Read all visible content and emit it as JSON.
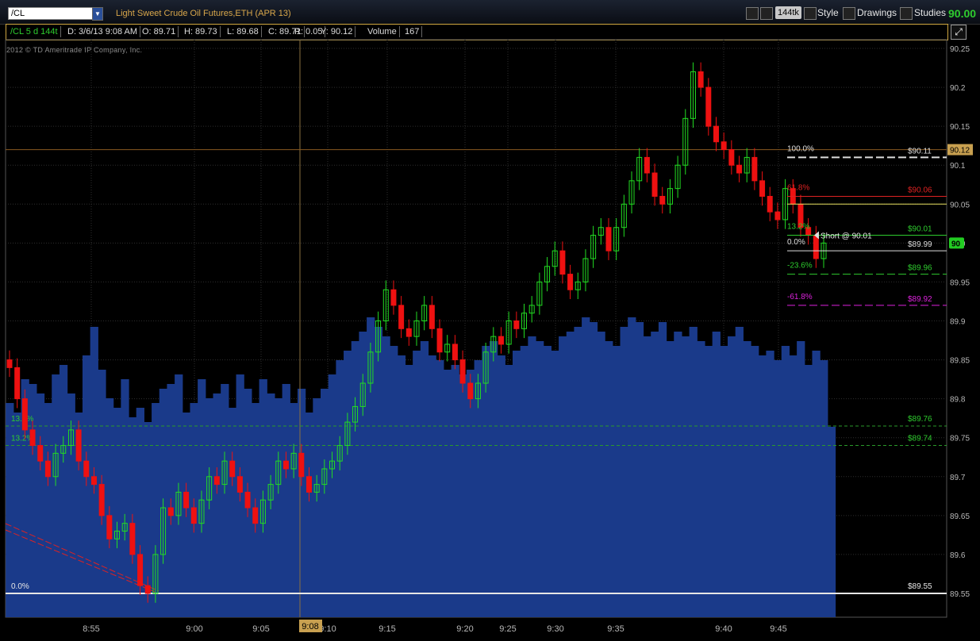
{
  "toolbar": {
    "symbol": "/CL",
    "symbol_arrow": "▼",
    "description": "Light Sweet Crude Oil Futures,ETH (APR 13)",
    "tick_badge": "144tk",
    "style_label": "Style",
    "drawings_label": "Drawings",
    "studies_label": "Studies",
    "last_price": "90.00"
  },
  "info_bar": {
    "chart_label": "/CL 5 d 144t",
    "date": "D: 3/6/13 9:08 AM",
    "open": "O: 89.71",
    "high": "H: 89.73",
    "low": "L: 89.68",
    "close": "C: 89.71",
    "range": "R: 0.05",
    "y": "Y: 90.12",
    "volume_label": "Volume",
    "volume_value": "167"
  },
  "copyright": "2012 © TD Ameritrade IP Company, Inc.",
  "colors": {
    "up": "#22dd22",
    "down": "#ee1111",
    "volume": "#1a3a8a",
    "grid": "#3a3a3a"
  },
  "chart_data": {
    "type": "candlestick",
    "ylim": [
      89.55,
      90.25
    ],
    "y_ticks": [
      "90.25",
      "90.2",
      "90.15",
      "90.1",
      "90.05",
      "90.0",
      "89.95",
      "89.9",
      "89.85",
      "89.8",
      "89.75",
      "89.7",
      "89.65",
      "89.6",
      "89.55"
    ],
    "x_ticks": [
      "8:55",
      "9:00",
      "9:05",
      "9:10",
      "9:15",
      "9:20",
      "9:25",
      "9:30",
      "9:35",
      "9:40",
      "9:45"
    ],
    "cursor_time": "9:08",
    "crosshair_price": "90.12",
    "current_price_tag": "90",
    "price_series": [
      89.84,
      89.8,
      89.76,
      89.74,
      89.72,
      89.7,
      89.73,
      89.74,
      89.76,
      89.72,
      89.7,
      89.69,
      89.65,
      89.62,
      89.63,
      89.64,
      89.6,
      89.56,
      89.55,
      89.6,
      89.66,
      89.65,
      89.68,
      89.66,
      89.64,
      89.67,
      89.7,
      89.69,
      89.72,
      89.7,
      89.68,
      89.66,
      89.64,
      89.67,
      89.69,
      89.72,
      89.71,
      89.73,
      89.7,
      89.68,
      89.69,
      89.71,
      89.72,
      89.74,
      89.77,
      89.79,
      89.82,
      89.86,
      89.9,
      89.94,
      89.92,
      89.89,
      89.88,
      89.9,
      89.92,
      89.89,
      89.86,
      89.87,
      89.85,
      89.82,
      89.8,
      89.82,
      89.86,
      89.88,
      89.87,
      89.9,
      89.89,
      89.91,
      89.92,
      89.95,
      89.97,
      89.99,
      89.96,
      89.94,
      89.95,
      89.98,
      90.01,
      90.02,
      89.99,
      90.02,
      90.05,
      90.08,
      90.11,
      90.09,
      90.06,
      90.05,
      90.07,
      90.1,
      90.16,
      90.22,
      90.2,
      90.15,
      90.13,
      90.12,
      90.1,
      90.09,
      90.11,
      90.08,
      90.06,
      90.04,
      90.03,
      90.07,
      90.05,
      90.02,
      90.01,
      89.98,
      90.0
    ],
    "volume": [
      40,
      38,
      45,
      44,
      42,
      40,
      46,
      48,
      42,
      38,
      50,
      56,
      47,
      41,
      39,
      45,
      37,
      39,
      36,
      40,
      43,
      44,
      46,
      38,
      40,
      45,
      41,
      42,
      44,
      39,
      46,
      43,
      40,
      45,
      42,
      41,
      44,
      40,
      43,
      38,
      41,
      43,
      46,
      49,
      51,
      53,
      55,
      58,
      56,
      54,
      52,
      50,
      48,
      51,
      53,
      50,
      49,
      47,
      48,
      46,
      47,
      49,
      52,
      53,
      50,
      48,
      51,
      52,
      54,
      53,
      52,
      51,
      54,
      55,
      56,
      58,
      57,
      55,
      53,
      52,
      56,
      58,
      57,
      54,
      55,
      57,
      53,
      55,
      54,
      56,
      53,
      52,
      55,
      52,
      54,
      56,
      53,
      52,
      50,
      51,
      49,
      52,
      50,
      53,
      48,
      51,
      49,
      35
    ],
    "fib_levels": [
      {
        "label": "100.0%",
        "price_label": "$90.11",
        "value": 90.11
      },
      {
        "label": "61.8%",
        "price_label": "$90.06",
        "value": 90.06
      },
      {
        "label": "13.2%",
        "price_label": "$90.01",
        "value": 90.01
      },
      {
        "label": "0.0%",
        "price_label": "$89.99",
        "value": 89.99
      },
      {
        "label": "-23.6%",
        "price_label": "$89.96",
        "value": 89.96
      },
      {
        "label": "-61.8%",
        "price_label": "$89.92",
        "value": 89.92
      }
    ],
    "left_fib_levels": [
      {
        "label": "13.2%",
        "price_label": "$89.76",
        "value": 89.765
      },
      {
        "label": "13.2%",
        "price_label": "$89.74",
        "value": 89.74
      },
      {
        "label": "0.0%",
        "price_label": "$89.55",
        "value": 89.55
      }
    ],
    "order_annotation": "Short @ 90.01"
  }
}
